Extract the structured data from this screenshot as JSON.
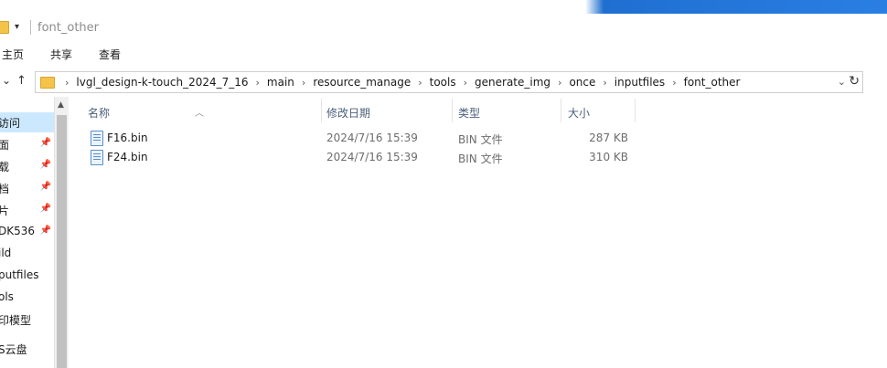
{
  "window": {
    "title": "font_other"
  },
  "ribbon": {
    "tabs": [
      "主页",
      "共享",
      "查看"
    ]
  },
  "address": {
    "crumbs": [
      "lvgl_design-k-touch_2024_7_16",
      "main",
      "resource_manage",
      "tools",
      "generate_img",
      "once",
      "inputfiles",
      "font_other"
    ],
    "chevron": "›"
  },
  "navpane": {
    "items": [
      {
        "label": "访问",
        "pinned": false,
        "selected": true
      },
      {
        "label": "面",
        "pinned": true
      },
      {
        "label": "载",
        "pinned": true
      },
      {
        "label": "档",
        "pinned": true
      },
      {
        "label": "片",
        "pinned": true
      },
      {
        "label": "DK536",
        "pinned": true
      },
      {
        "label": "ild",
        "pinned": false
      },
      {
        "label": "putfiles",
        "pinned": false
      },
      {
        "label": "ols",
        "pinned": false
      },
      {
        "label": "印模型",
        "pinned": false
      },
      {
        "label": "S云盘",
        "pinned": false
      }
    ],
    "pin_glyph": "📌"
  },
  "columns": {
    "name": "名称",
    "date": "修改日期",
    "type": "类型",
    "size": "大小"
  },
  "files": [
    {
      "name": "F16.bin",
      "date": "2024/7/16 15:39",
      "type": "BIN 文件",
      "size": "287 KB"
    },
    {
      "name": "F24.bin",
      "date": "2024/7/16 15:39",
      "type": "BIN 文件",
      "size": "310 KB"
    }
  ],
  "colors": {
    "accent": "#1f6fd1",
    "selection": "#cce8ff",
    "folder": "#f3c34a"
  }
}
